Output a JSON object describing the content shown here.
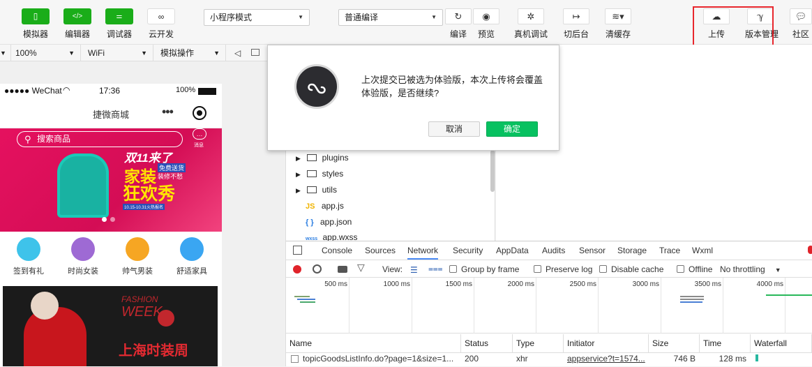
{
  "toolbar": {
    "simulator": "模拟器",
    "editor": "编辑器",
    "debugger": "调试器",
    "cloud": "云开发",
    "mode_select": "小程序模式",
    "compile_select": "普通编译",
    "compile": "编译",
    "preview": "预览",
    "real_debug": "真机调试",
    "background": "切后台",
    "clear_cache": "清缓存",
    "upload": "上传",
    "version": "版本管理",
    "community": "社区"
  },
  "subbar": {
    "zoom": "100%",
    "network": "WiFi",
    "operation": "模拟操作"
  },
  "phone": {
    "carrier": "●●●●● WeChat",
    "time": "17:36",
    "battery": "100%",
    "nav_title": "捷微商城",
    "search_placeholder": "搜索商品",
    "msg_label": "消息",
    "banner_line1": "双11来了",
    "banner_line2": "家装",
    "banner_line3": "狂欢秀",
    "banner_tag1": "免费送货",
    "banner_tag2": "装修不愁",
    "banner_date": "10.15-10.31火热报名",
    "categories": [
      "签到有礼",
      "时尚女装",
      "帅气男装",
      "舒适家具"
    ],
    "feature_line1": "FASHION",
    "feature_line2": "WEEK",
    "feature_line3": "上海时装周"
  },
  "filetree": {
    "items": [
      {
        "name": "plugins",
        "type": "folder"
      },
      {
        "name": "styles",
        "type": "folder"
      },
      {
        "name": "utils",
        "type": "folder"
      },
      {
        "name": "app.js",
        "type": "js",
        "icon": "JS"
      },
      {
        "name": "app.json",
        "type": "json",
        "icon": "{ }"
      },
      {
        "name": "app.wxss",
        "type": "wxss",
        "icon": "wxss"
      }
    ]
  },
  "dialog": {
    "message": "上次提交已被选为体验版，本次上传将会覆盖体验版，是否继续?",
    "cancel": "取消",
    "confirm": "确定",
    "accent": "#07c160"
  },
  "devtools": {
    "tabs": [
      "Console",
      "Sources",
      "Network",
      "Security",
      "AppData",
      "Audits",
      "Sensor",
      "Storage",
      "Trace",
      "Wxml"
    ],
    "active_tab": "Network",
    "view_label": "View:",
    "group_by_frame": "Group by frame",
    "preserve_log": "Preserve log",
    "disable_cache": "Disable cache",
    "offline": "Offline",
    "throttling": "No throttling",
    "ticks": [
      "500 ms",
      "1000 ms",
      "1500 ms",
      "2000 ms",
      "2500 ms",
      "3000 ms",
      "3500 ms",
      "4000 ms"
    ],
    "columns": [
      "Name",
      "Status",
      "Type",
      "Initiator",
      "Size",
      "Time",
      "Waterfall"
    ],
    "row": {
      "name": "topicGoodsListInfo.do?page=1&size=1...",
      "status": "200",
      "type": "xhr",
      "initiator": "appservice?t=1574...",
      "size": "746 B",
      "time": "128 ms"
    }
  }
}
